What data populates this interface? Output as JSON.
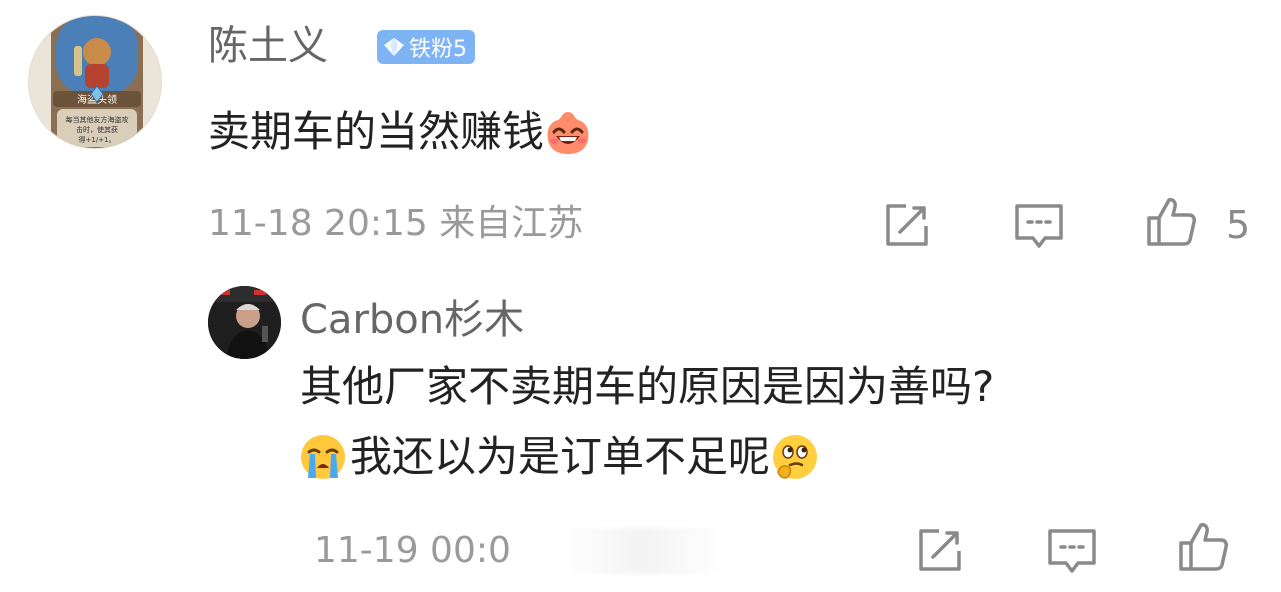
{
  "comment": {
    "username": "陈土义",
    "badge_label": "铁粉5",
    "text": "卖期车的当然赚钱",
    "meta": "11-18 20:15 来自江苏",
    "like_count": "5",
    "avatar_card_title": "海盗头领",
    "avatar_card_text_1": "每当其他友方海盗攻",
    "avatar_card_text_2": "击时，使其获",
    "avatar_card_text_3": "得+1/+1。"
  },
  "reply": {
    "username": "Carbon杉木",
    "line1": "其他厂家不卖期车的原因是因为善吗?",
    "line2": "我还以为是订单不足呢",
    "meta": "11-19 00:0"
  },
  "icons": {
    "emoji_laugh": "laugh-emoji-icon",
    "emoji_cry": "cry-emoji-icon",
    "emoji_think": "thinking-emoji-icon",
    "repost": "repost-icon",
    "comment": "comment-icon",
    "like": "thumbs-up-icon"
  },
  "colors": {
    "badge_bg": "#7eb4f4",
    "username": "#666666",
    "meta": "#9a9a9a",
    "text": "#222222"
  }
}
